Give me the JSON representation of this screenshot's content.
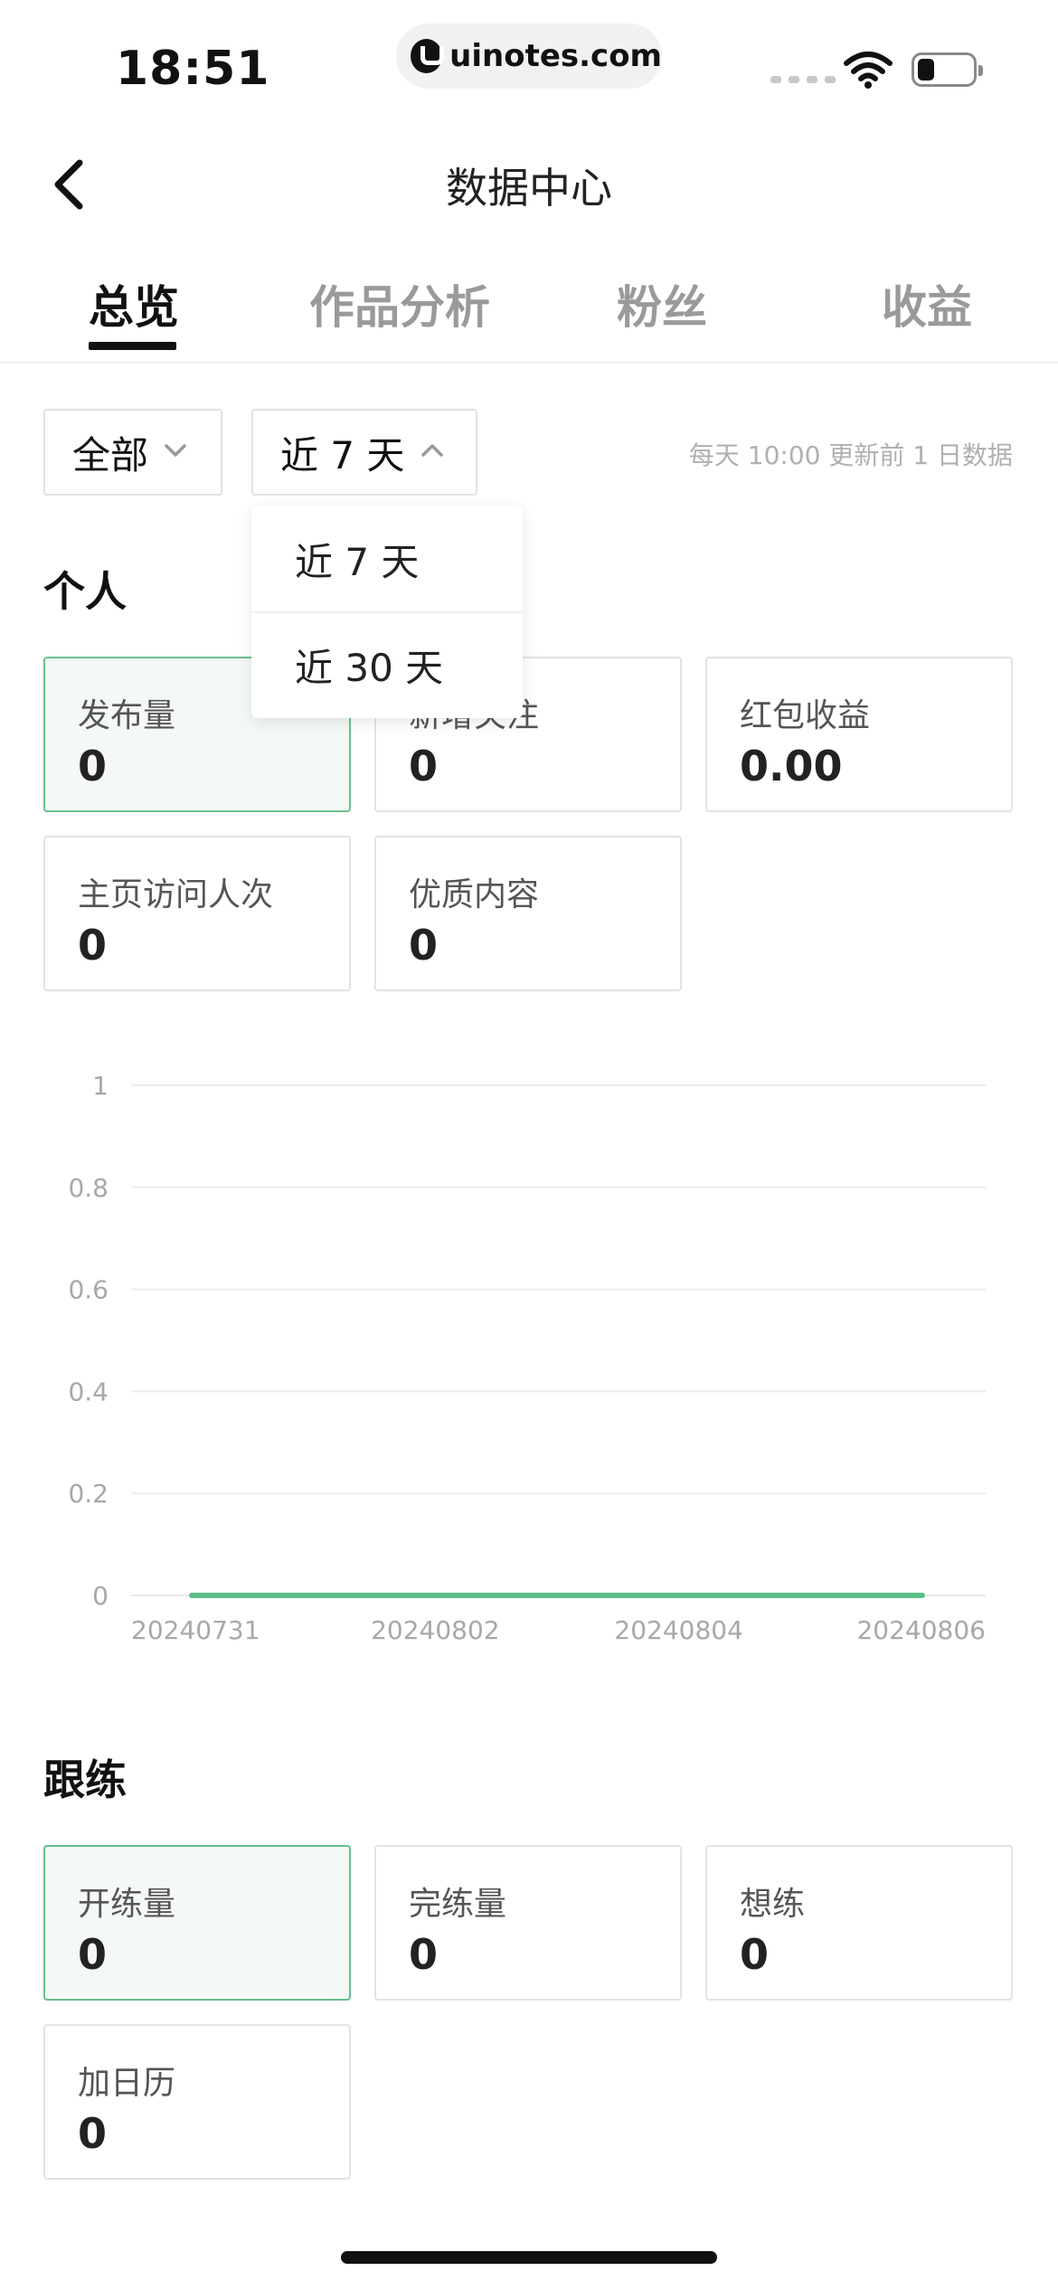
{
  "status_bar": {
    "time": "18:51",
    "url": "uinotes.com",
    "logo_icon": "uinotes-logo-icon",
    "wifi_icon": "wifi-icon",
    "battery_icon": "battery-icon",
    "battery_level": 0.3
  },
  "nav": {
    "back_icon": "chevron-left-icon",
    "title": "数据中心"
  },
  "tabs": [
    {
      "label": "总览",
      "active": true
    },
    {
      "label": "作品分析",
      "active": false
    },
    {
      "label": "粉丝",
      "active": false
    },
    {
      "label": "收益",
      "active": false
    }
  ],
  "filters": {
    "scope": {
      "label": "全部",
      "icon": "chevron-down-icon"
    },
    "range": {
      "label": "近 7 天",
      "icon": "chevron-up-icon"
    },
    "update_note": "每天 10:00 更新前 1 日数据"
  },
  "dropdown": {
    "options": [
      "近 7 天",
      "近 30 天"
    ]
  },
  "personal": {
    "title": "个人",
    "cards": [
      {
        "label": "发布量",
        "value": "0",
        "selected": true
      },
      {
        "label": "新增关注",
        "value": "0",
        "selected": false
      },
      {
        "label": "红包收益",
        "value": "0.00",
        "selected": false
      },
      {
        "label": "主页访问人次",
        "value": "0",
        "selected": false
      },
      {
        "label": "优质内容",
        "value": "0",
        "selected": false
      }
    ]
  },
  "chart_data": {
    "type": "line",
    "x": [
      "20240731",
      "20240801",
      "20240802",
      "20240803",
      "20240804",
      "20240805",
      "20240806"
    ],
    "x_tick_labels": [
      "20240731",
      "20240802",
      "20240804",
      "20240806"
    ],
    "series": [
      {
        "values": [
          0,
          0,
          0,
          0,
          0,
          0,
          0
        ],
        "color": "#5cbf87"
      }
    ],
    "y_ticks": [
      "1",
      "0.8",
      "0.6",
      "0.4",
      "0.2",
      "0"
    ],
    "ylim": [
      0,
      1
    ],
    "grid": true,
    "title": "",
    "xlabel": "",
    "ylabel": ""
  },
  "practice": {
    "title": "跟练",
    "cards": [
      {
        "label": "开练量",
        "value": "0",
        "selected": true
      },
      {
        "label": "完练量",
        "value": "0",
        "selected": false
      },
      {
        "label": "想练",
        "value": "0",
        "selected": false
      },
      {
        "label": "加日历",
        "value": "0",
        "selected": false
      }
    ]
  },
  "colors": {
    "accent": "#5cbf87",
    "card_selected_border": "#67c08b",
    "muted_text": "#9a9a9a"
  }
}
